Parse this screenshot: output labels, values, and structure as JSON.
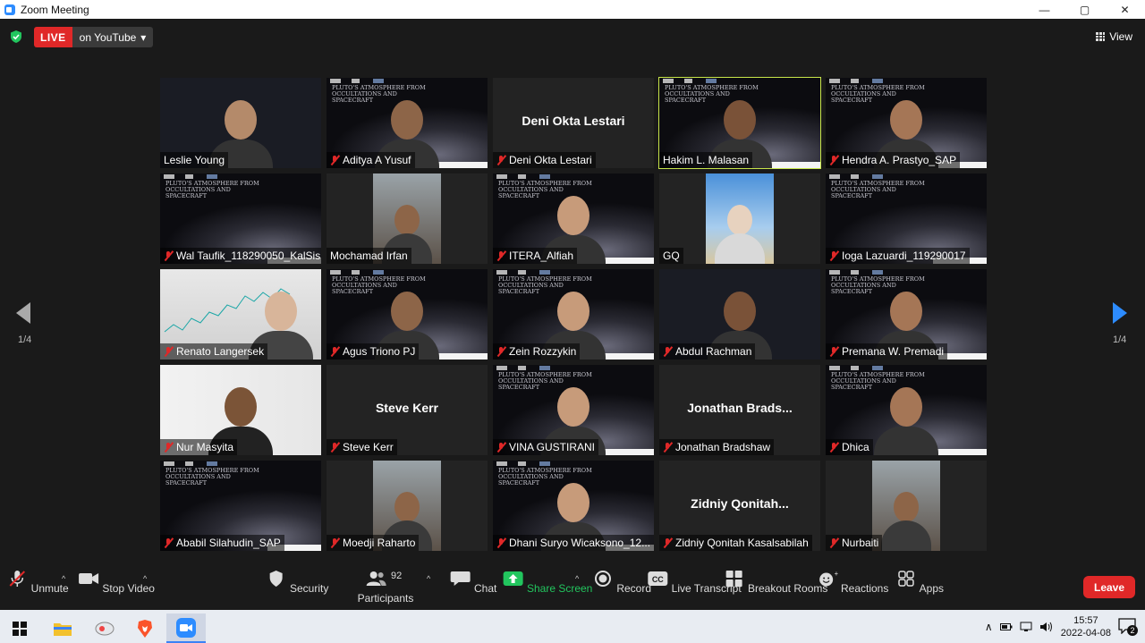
{
  "window": {
    "title": "Zoom Meeting",
    "minimize": "—",
    "restore": "▢",
    "close": "✕"
  },
  "header": {
    "live_badge": "LIVE",
    "stream_label": "on YouTube",
    "stream_caret": "▾",
    "view_label": "View"
  },
  "pager": {
    "left_label": "1/4",
    "right_label": "1/4"
  },
  "slide": {
    "title_text": "PLUTO'S ATMOSPHERE FROM OCCULTATIONS AND SPACECRAFT"
  },
  "participants": [
    {
      "name": "Leslie Young",
      "muted": false,
      "kind": "video"
    },
    {
      "name": "Aditya A Yusuf",
      "muted": true,
      "kind": "video-slide"
    },
    {
      "name": "Deni Okta Lestari",
      "muted": true,
      "kind": "name",
      "big": "Deni Okta Lestari"
    },
    {
      "name": "Hakim L. Malasan",
      "muted": false,
      "kind": "video-slide",
      "active": true
    },
    {
      "name": "Hendra A. Prastyo_SAP",
      "muted": true,
      "kind": "video-slide"
    },
    {
      "name": "Wal Taufik_118290050_KalSis",
      "muted": true,
      "kind": "slide"
    },
    {
      "name": "Mochamad Irfan",
      "muted": false,
      "kind": "photo"
    },
    {
      "name": "ITERA_Alfiah",
      "muted": true,
      "kind": "video-slide"
    },
    {
      "name": "GQ",
      "muted": false,
      "kind": "photo-sky"
    },
    {
      "name": "Ioga Lazuardi_119290017",
      "muted": true,
      "kind": "slide"
    },
    {
      "name": "Renato Langersek",
      "muted": true,
      "kind": "chart"
    },
    {
      "name": "Agus Triono PJ",
      "muted": true,
      "kind": "video-slide"
    },
    {
      "name": "Zein Rozzykin",
      "muted": true,
      "kind": "video-slide"
    },
    {
      "name": "Abdul Rachman",
      "muted": true,
      "kind": "video"
    },
    {
      "name": "Premana W. Premadi",
      "muted": true,
      "kind": "video-slide"
    },
    {
      "name": "Nur Masyita",
      "muted": true,
      "kind": "video-light"
    },
    {
      "name": "Steve Kerr",
      "muted": true,
      "kind": "name",
      "big": "Steve Kerr"
    },
    {
      "name": "VINA GUSTIRANI",
      "muted": true,
      "kind": "video-slide"
    },
    {
      "name": "Jonathan Bradshaw",
      "muted": true,
      "kind": "name",
      "big": "Jonathan  Brads..."
    },
    {
      "name": "Dhica",
      "muted": true,
      "kind": "video-slide"
    },
    {
      "name": "Ababil Silahudin_SAP",
      "muted": true,
      "kind": "slide"
    },
    {
      "name": "Moedji Raharto",
      "muted": true,
      "kind": "photo"
    },
    {
      "name": "Dhani Suryo Wicaksono_12...",
      "muted": true,
      "kind": "video-slide"
    },
    {
      "name": "Zidniy Qonitah Kasalsabilah",
      "muted": true,
      "kind": "name",
      "big": "Zidniy  Qonitah..."
    },
    {
      "name": "Nurbaiti",
      "muted": true,
      "kind": "photo"
    }
  ],
  "toolbar": {
    "unmute": "Unmute",
    "stop_video": "Stop Video",
    "security": "Security",
    "participants": "Participants",
    "participants_count": "92",
    "chat": "Chat",
    "share_screen": "Share Screen",
    "record": "Record",
    "live_transcript": "Live Transcript",
    "breakout_rooms": "Breakout Rooms",
    "reactions": "Reactions",
    "apps": "Apps",
    "leave": "Leave",
    "caret": "^"
  },
  "taskbar": {
    "time": "15:57",
    "date": "2022-04-08",
    "notifications": "2"
  },
  "colors": {
    "live": "#e02828",
    "accent": "#2d8cff",
    "share": "#22c55e",
    "active_border": "#c8e64a"
  }
}
